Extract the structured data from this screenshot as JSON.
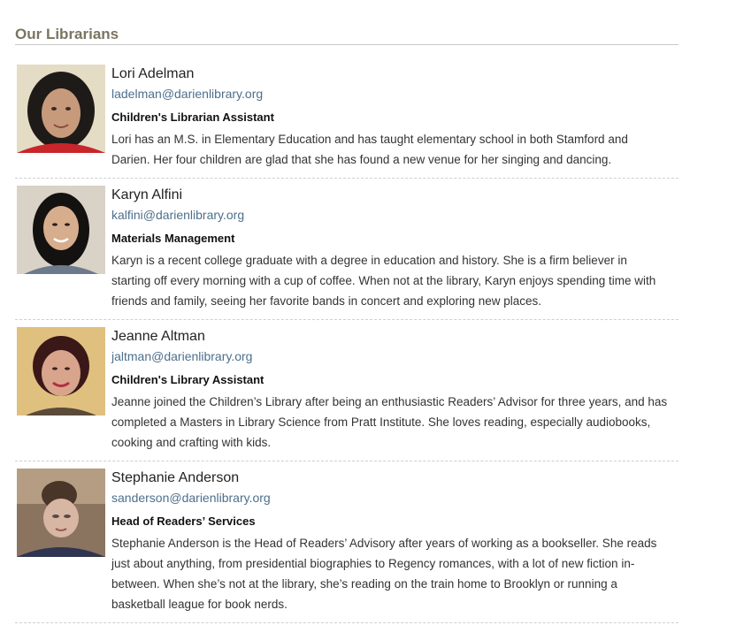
{
  "section": {
    "title": "Our Librarians"
  },
  "librarians": [
    {
      "name": "Lori Adelman",
      "email": "ladelman@darienlibrary.org",
      "role": "Children's Librarian Assistant",
      "bio": "Lori has an M.S. in Elementary Education and has taught elementary school in both Stamford and Darien.  Her four children are glad that she has found a new venue for her singing and dancing."
    },
    {
      "name": "Karyn Alfini",
      "email": "kalfini@darienlibrary.org",
      "role": "Materials Management",
      "bio": "Karyn is a recent college graduate with a degree in education and history. She is a firm believer in starting off every morning with a cup of coffee. When not at the library, Karyn enjoys spending time with friends and family, seeing her favorite bands in concert and exploring new places."
    },
    {
      "name": "Jeanne Altman",
      "email": "jaltman@darienlibrary.org",
      "role": "Children's Library Assistant",
      "bio": "Jeanne joined the Children’s Library after being an enthusiastic Readers’ Advisor for three years, and has completed a Masters in Library Science from Pratt Institute. She loves reading, especially audiobooks, cooking and crafting with kids."
    },
    {
      "name": "Stephanie Anderson",
      "email": "sanderson@darienlibrary.org",
      "role": "Head of Readers’ Services",
      "bio": "Stephanie Anderson is the Head of Readers’ Advisory after years of working as a bookseller. She reads just about anything, from presidential biographies to Regency romances, with a lot of new fiction in-between. When she’s not at the library, she’s reading on the train home to Brooklyn or running a basketball league for book nerds."
    }
  ]
}
